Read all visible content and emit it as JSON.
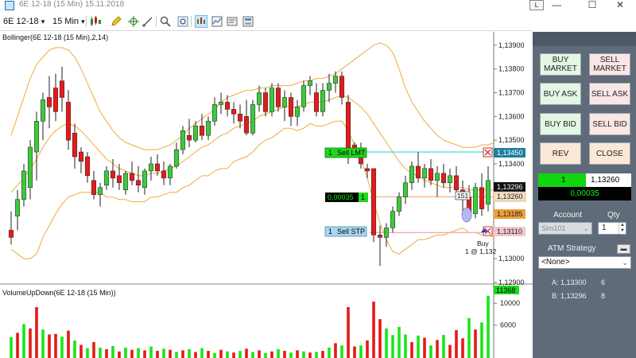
{
  "window": {
    "title": "6E 12-18 (15 Min)  15.11.2018",
    "layout_button": "L",
    "minimize": "—",
    "maximize": "☐",
    "close": "✕"
  },
  "toolbar": {
    "instrument": "6E 12-18",
    "interval": "15 Min",
    "dropdown_icon": "▾"
  },
  "price_panel": {
    "indicator_title": "Bollinger(6E 12-18 (15 Min),2,14)",
    "y_ticks": [
      "1,13900",
      "1,13800",
      "1,13700",
      "1,13600",
      "1,13500",
      "1,13400",
      "1,13300",
      "1,13000",
      "1,12900"
    ],
    "ylim": [
      1.129,
      1.1395
    ],
    "sell_limit_order": {
      "qty": "1",
      "label": "Sell LMT",
      "price_label": "1,13450",
      "price": 1.1345
    },
    "sell_stop_order": {
      "qty": "1",
      "label": "Sell STP",
      "price_label": "1,13110",
      "price": 1.1311
    },
    "position": {
      "pnl": "0,00035",
      "qty": "1",
      "avg_price": 1.13261
    },
    "current_price_tag": "1,13296",
    "last_price_tag": "1,13260",
    "stop_tag": "1,13185",
    "position_flag": "151",
    "execution_label_1": "Buy",
    "execution_label_2": "1 @ 1,132",
    "colors": {
      "up": "#3ec93e",
      "down": "#e41c1c",
      "band": "#f2a93b",
      "limit_line": "#30d5d8",
      "stop_line": "#f2a8b5",
      "entry_line": "#f0a060"
    }
  },
  "volume_panel": {
    "title": "VolumeUpDown(6E 12-18 (15 Min))",
    "y_ticks": [
      "10000",
      "6000"
    ],
    "ylim": [
      0,
      12500
    ],
    "last_volume_tag": "11368",
    "colors": {
      "up": "#19e619",
      "down": "#e61919"
    }
  },
  "chart_data": {
    "type": "candlestick",
    "price": {
      "ohlc": [
        [
          1.1312,
          1.132,
          1.1306,
          1.1309
        ],
        [
          1.1318,
          1.1329,
          1.1312,
          1.1325
        ],
        [
          1.1325,
          1.134,
          1.1322,
          1.1337
        ],
        [
          1.133,
          1.135,
          1.1325,
          1.1347
        ],
        [
          1.1345,
          1.1362,
          1.1333,
          1.1358
        ],
        [
          1.1358,
          1.137,
          1.135,
          1.1367
        ],
        [
          1.1368,
          1.1377,
          1.1355,
          1.1364
        ],
        [
          1.1372,
          1.1378,
          1.1358,
          1.1362
        ],
        [
          1.1375,
          1.1381,
          1.1362,
          1.1368
        ],
        [
          1.1366,
          1.1371,
          1.1346,
          1.135
        ],
        [
          1.1353,
          1.1357,
          1.1338,
          1.1343
        ],
        [
          1.1345,
          1.1347,
          1.1336,
          1.1341
        ],
        [
          1.1343,
          1.1345,
          1.1332,
          1.1335
        ],
        [
          1.1333,
          1.1337,
          1.1325,
          1.1327
        ],
        [
          1.1327,
          1.1332,
          1.1322,
          1.133
        ],
        [
          1.1331,
          1.1339,
          1.1329,
          1.1337
        ],
        [
          1.1337,
          1.1342,
          1.133,
          1.1334
        ],
        [
          1.1335,
          1.134,
          1.1329,
          1.1332
        ],
        [
          1.1329,
          1.1337,
          1.1327,
          1.1336
        ],
        [
          1.1336,
          1.1341,
          1.1331,
          1.1333
        ],
        [
          1.1333,
          1.1339,
          1.1328,
          1.1331
        ],
        [
          1.133,
          1.1338,
          1.1327,
          1.1337
        ],
        [
          1.1337,
          1.1343,
          1.1333,
          1.134
        ],
        [
          1.134,
          1.1344,
          1.1335,
          1.1337
        ],
        [
          1.1337,
          1.1341,
          1.1331,
          1.1334
        ],
        [
          1.1334,
          1.134,
          1.1331,
          1.1339
        ],
        [
          1.1339,
          1.1349,
          1.1338,
          1.1346
        ],
        [
          1.1346,
          1.1356,
          1.1344,
          1.1354
        ],
        [
          1.1352,
          1.1359,
          1.1347,
          1.135
        ],
        [
          1.135,
          1.1358,
          1.1349,
          1.1356
        ],
        [
          1.1356,
          1.1361,
          1.135,
          1.1352
        ],
        [
          1.1352,
          1.136,
          1.135,
          1.1358
        ],
        [
          1.1358,
          1.1368,
          1.1356,
          1.1365
        ],
        [
          1.1365,
          1.137,
          1.1361,
          1.1366
        ],
        [
          1.1366,
          1.1369,
          1.136,
          1.1363
        ],
        [
          1.1363,
          1.1366,
          1.1357,
          1.1361
        ],
        [
          1.1361,
          1.1365,
          1.1355,
          1.1358
        ],
        [
          1.136,
          1.1367,
          1.1352,
          1.1353
        ],
        [
          1.1353,
          1.1367,
          1.1352,
          1.1365
        ],
        [
          1.1365,
          1.1373,
          1.1362,
          1.137
        ],
        [
          1.137,
          1.1372,
          1.136,
          1.1362
        ],
        [
          1.1362,
          1.1374,
          1.136,
          1.1372
        ],
        [
          1.1372,
          1.1374,
          1.1362,
          1.1364
        ],
        [
          1.1364,
          1.1371,
          1.1358,
          1.1368
        ],
        [
          1.1368,
          1.137,
          1.1356,
          1.136
        ],
        [
          1.136,
          1.1367,
          1.1356,
          1.1364
        ],
        [
          1.1364,
          1.1375,
          1.1362,
          1.1373
        ],
        [
          1.1373,
          1.1377,
          1.1369,
          1.1375
        ],
        [
          1.137,
          1.1374,
          1.136,
          1.1362
        ],
        [
          1.1362,
          1.1374,
          1.136,
          1.1371
        ],
        [
          1.1371,
          1.1378,
          1.1366,
          1.1374
        ],
        [
          1.1374,
          1.1379,
          1.137,
          1.1377
        ],
        [
          1.1377,
          1.1379,
          1.1365,
          1.1368
        ],
        [
          1.1366,
          1.1369,
          1.134,
          1.1345
        ],
        [
          1.1348,
          1.1349,
          1.1343,
          1.1346
        ],
        [
          1.1345,
          1.1349,
          1.1338,
          1.134
        ],
        [
          1.1338,
          1.134,
          1.1334,
          1.1337
        ],
        [
          1.1338,
          1.1338,
          1.1307,
          1.131
        ],
        [
          1.131,
          1.1314,
          1.1297,
          1.1309
        ],
        [
          1.1309,
          1.1315,
          1.1305,
          1.1313
        ],
        [
          1.1313,
          1.1322,
          1.1311,
          1.132
        ],
        [
          1.132,
          1.1328,
          1.1318,
          1.1326
        ],
        [
          1.1326,
          1.1335,
          1.1323,
          1.1332
        ],
        [
          1.1332,
          1.1341,
          1.1329,
          1.1339
        ],
        [
          1.1339,
          1.1345,
          1.1332,
          1.1334
        ],
        [
          1.1334,
          1.134,
          1.133,
          1.1338
        ],
        [
          1.1338,
          1.1342,
          1.1331,
          1.1333
        ],
        [
          1.1333,
          1.1339,
          1.1326,
          1.1336
        ],
        [
          1.1336,
          1.134,
          1.133,
          1.1332
        ],
        [
          1.1332,
          1.1338,
          1.1328,
          1.1335
        ],
        [
          1.1335,
          1.1339,
          1.1326,
          1.1329
        ],
        [
          1.1329,
          1.1333,
          1.1319,
          1.1326
        ],
        [
          1.1326,
          1.1331,
          1.1316,
          1.1319
        ],
        [
          1.1319,
          1.1332,
          1.1317,
          1.133
        ],
        [
          1.133,
          1.1336,
          1.1318,
          1.1321
        ],
        [
          1.1323,
          1.1339,
          1.132,
          1.1333
        ]
      ],
      "upper_band": [
        1.1352,
        1.136,
        1.1368,
        1.1376,
        1.1382,
        1.1385,
        1.1388,
        1.1389,
        1.1389,
        1.1388,
        1.1385,
        1.138,
        1.1374,
        1.1368,
        1.1362,
        1.1358,
        1.1354,
        1.1351,
        1.1349,
        1.1348,
        1.1347,
        1.1346,
        1.1346,
        1.1346,
        1.1347,
        1.1348,
        1.135,
        1.1352,
        1.1355,
        1.1357,
        1.1359,
        1.1361,
        1.1363,
        1.1366,
        1.1368,
        1.1369,
        1.137,
        1.1371,
        1.1371,
        1.1372,
        1.1372,
        1.1373,
        1.1373,
        1.1373,
        1.1373,
        1.1374,
        1.1375,
        1.1375,
        1.1376,
        1.1376,
        1.1377,
        1.1378,
        1.138,
        1.1382,
        1.1384,
        1.1386,
        1.1388,
        1.139,
        1.1391,
        1.139,
        1.1387,
        1.138,
        1.1372,
        1.1366,
        1.1362,
        1.1358,
        1.1355,
        1.1352,
        1.135,
        1.1349,
        1.1348,
        1.1347,
        1.1347,
        1.1347,
        1.1348,
        1.1348,
        1.1349
      ],
      "middle_band": [
        1.1328,
        1.1331,
        1.1334,
        1.1338,
        1.1342,
        1.1347,
        1.1351,
        1.1354,
        1.1356,
        1.1357,
        1.1356,
        1.1354,
        1.1351,
        1.1348,
        1.1345,
        1.1342,
        1.134,
        1.1338,
        1.1337,
        1.1336,
        1.1335,
        1.1335,
        1.1336,
        1.1336,
        1.1337,
        1.1338,
        1.1339,
        1.1341,
        1.1343,
        1.1345,
        1.1347,
        1.1348,
        1.135,
        1.1352,
        1.1353,
        1.1355,
        1.1356,
        1.1357,
        1.1358,
        1.136,
        1.1361,
        1.1362,
        1.1363,
        1.1364,
        1.1364,
        1.1364,
        1.1365,
        1.1366,
        1.1366,
        1.1366,
        1.1367,
        1.1368,
        1.1369,
        1.1368,
        1.1366,
        1.1364,
        1.1361,
        1.1357,
        1.1353,
        1.1349,
        1.1345,
        1.1341,
        1.1338,
        1.1336,
        1.1335,
        1.1333,
        1.1332,
        1.1331,
        1.133,
        1.133,
        1.133,
        1.133,
        1.1329,
        1.1329,
        1.1329,
        1.1329,
        1.1329
      ],
      "lower_band": [
        1.1304,
        1.1302,
        1.13,
        1.13,
        1.1302,
        1.1309,
        1.1314,
        1.1319,
        1.1323,
        1.1326,
        1.1327,
        1.1328,
        1.1328,
        1.1328,
        1.1328,
        1.1326,
        1.1326,
        1.1325,
        1.1325,
        1.1324,
        1.1324,
        1.1324,
        1.1326,
        1.1326,
        1.1327,
        1.1328,
        1.1328,
        1.133,
        1.1331,
        1.1333,
        1.1335,
        1.1335,
        1.1337,
        1.1338,
        1.1338,
        1.1341,
        1.1342,
        1.1343,
        1.1345,
        1.1348,
        1.135,
        1.1351,
        1.1353,
        1.1355,
        1.1355,
        1.1354,
        1.1355,
        1.1357,
        1.1356,
        1.1356,
        1.1357,
        1.1358,
        1.1358,
        1.1354,
        1.1348,
        1.1342,
        1.1334,
        1.1324,
        1.1315,
        1.1308,
        1.1303,
        1.1302,
        1.1304,
        1.1306,
        1.1308,
        1.1308,
        1.1309,
        1.131,
        1.131,
        1.1311,
        1.1312,
        1.1313,
        1.1311,
        1.1311,
        1.131,
        1.131,
        1.1309
      ]
    },
    "volume": {
      "values": [
        3800,
        4600,
        6200,
        5400,
        9300,
        5200,
        4300,
        4400,
        3900,
        5000,
        3200,
        2400,
        1800,
        2900,
        1900,
        1600,
        2200,
        1200,
        1900,
        1500,
        1800,
        1400,
        2100,
        1300,
        1700,
        1500,
        1100,
        1400,
        1600,
        1100,
        1800,
        1300,
        900,
        1500,
        1200,
        1000,
        1300,
        1700,
        1100,
        1400,
        900,
        1200,
        1600,
        1300,
        1000,
        1400,
        1200,
        1000,
        1100,
        1300,
        1900,
        2700,
        2300,
        9300,
        2100,
        2300,
        3200,
        10300,
        7100,
        5400,
        4200,
        5700,
        4300,
        2900,
        4100,
        3700,
        2300,
        3300,
        4200,
        2400,
        5100,
        3600,
        7300,
        5200,
        6500,
        11368
      ],
      "direction": [
        "up",
        "down",
        "up",
        "down",
        "down",
        "up",
        "down",
        "down",
        "up",
        "down",
        "up",
        "down",
        "up",
        "down",
        "up",
        "down",
        "up",
        "down",
        "up",
        "down",
        "up",
        "down",
        "up",
        "down",
        "up",
        "down",
        "up",
        "down",
        "up",
        "down",
        "up",
        "down",
        "up",
        "down",
        "up",
        "down",
        "up",
        "down",
        "up",
        "down",
        "up",
        "down",
        "up",
        "down",
        "up",
        "down",
        "up",
        "down",
        "up",
        "down",
        "up",
        "down",
        "up",
        "down",
        "down",
        "up",
        "down",
        "down",
        "down",
        "up",
        "up",
        "up",
        "up",
        "down",
        "up",
        "down",
        "up",
        "down",
        "up",
        "down",
        "down",
        "down",
        "up",
        "down",
        "up",
        "up"
      ]
    }
  },
  "order_panel": {
    "buy_market": "BUY MARKET",
    "sell_market": "SELL MARKET",
    "buy_ask": "BUY ASK",
    "sell_ask": "SELL ASK",
    "buy_bid": "BUY BID",
    "sell_bid": "SELL BID",
    "rev": "REV",
    "close": "CLOSE",
    "position_qty": "1",
    "position_price": "1,13260",
    "position_pnl": "0,00035",
    "account_label": "Account",
    "qty_label": "Qty",
    "account_value": "Sim101",
    "qty_value": "1",
    "atm_label": "ATM Strategy",
    "atm_value": "<None>",
    "ask_label": "A: 1,13300",
    "ask_size": "6",
    "bid_label": "B: 1,13296",
    "bid_size": "8"
  }
}
